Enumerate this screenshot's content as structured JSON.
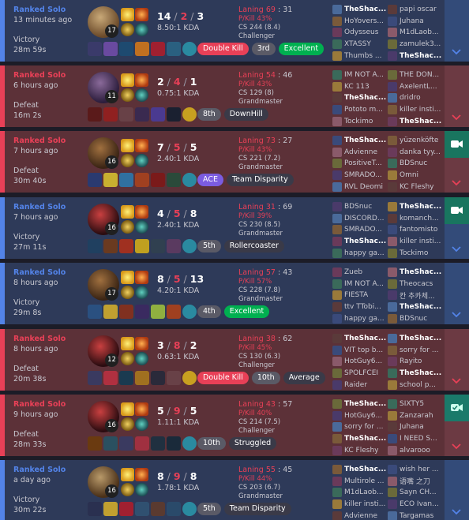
{
  "colors": {
    "win_bg": "#2e3a59",
    "loss_bg": "#5c3138",
    "win_accent": "#5383e8",
    "loss_accent": "#e84057",
    "video_button": "#19755f"
  },
  "icons": {
    "expand": "chevron-down-icon",
    "video": "video-camera-icon",
    "video_check": "video-check-icon"
  },
  "matches": [
    {
      "queue": "Ranked Solo",
      "time_ago": "13 minutes ago",
      "result": "Victory",
      "duration": "28m 59s",
      "champion_level": "17",
      "kills": "14",
      "deaths": "2",
      "assists": "3",
      "kda_ratio": "8.50:1 KDA",
      "badges": [
        {
          "label": "Double Kill",
          "color": "red"
        },
        {
          "label": "3rd",
          "color": "gray"
        },
        {
          "label": "Excellent",
          "color": "green"
        }
      ],
      "laning_label": "Laning 69",
      "laning_opp": ": 31",
      "pkill_label": "P/Kill 43%",
      "cs": "CS 244 (8.4)",
      "tier": "Challenger",
      "team1": [
        "TheShac...",
        "HoYovers...",
        "Odysseus",
        "XTASSY",
        "Thumbs ..."
      ],
      "team2": [
        "papi oscar",
        "Juhana",
        "M1dLaob...",
        "zamulek3...",
        "TheShac..."
      ]
    },
    {
      "queue": "Ranked Solo",
      "time_ago": "6 hours ago",
      "result": "Defeat",
      "duration": "16m 2s",
      "champion_level": "11",
      "kills": "2",
      "deaths": "4",
      "assists": "1",
      "kda_ratio": "0.75:1 KDA",
      "badges": [
        {
          "label": "8th",
          "color": "gray"
        },
        {
          "label": "DownHill",
          "color": "dark"
        }
      ],
      "laning_label": "Laning 54",
      "laning_opp": ": 46",
      "pkill_label": "P/Kill 43%",
      "cs": "CS 129 (8)",
      "tier": "Grandmaster",
      "team1": [
        "IM NOT A...",
        "KC 113",
        "TheShac...",
        "Pototo m...",
        "Tockimo"
      ],
      "team2": [
        "THE DON...",
        "AxelentL...",
        "dridro",
        "killer insti...",
        "TheShac..."
      ]
    },
    {
      "queue": "Ranked Solo",
      "time_ago": "7 hours ago",
      "result": "Defeat",
      "duration": "30m 40s",
      "champion_level": "16",
      "kills": "7",
      "deaths": "5",
      "assists": "5",
      "kda_ratio": "2.40:1 KDA",
      "badges": [
        {
          "label": "ACE",
          "color": "purple"
        },
        {
          "label": "Team Disparity",
          "color": "dark"
        }
      ],
      "laning_label": "Laning 73",
      "laning_opp": ": 27",
      "pkill_label": "P/Kill 43%",
      "cs": "CS 221 (7.2)",
      "tier": "Grandmaster",
      "team1": [
        "TheShac...",
        "Advienne",
        "PositiveT...",
        "SMRADO...",
        "RVL Deomi"
      ],
      "team2": [
        "yüzenköfte",
        "danka tyy...",
        "BDSnuc",
        "Omni",
        "KC Fleshy"
      ]
    },
    {
      "queue": "Ranked Solo",
      "time_ago": "7 hours ago",
      "result": "Victory",
      "duration": "27m 11s",
      "champion_level": "16",
      "kills": "4",
      "deaths": "5",
      "assists": "8",
      "kda_ratio": "2.40:1 KDA",
      "badges": [
        {
          "label": "5th",
          "color": "gray"
        },
        {
          "label": "Rollercoaster",
          "color": "dark"
        }
      ],
      "laning_label": "Laning 31",
      "laning_opp": ": 69",
      "pkill_label": "P/Kill 39%",
      "cs": "CS 230 (8.5)",
      "tier": "Grandmaster",
      "team1": [
        "BDSnuc",
        "DISCORD...",
        "SMRADO...",
        "TheShac...",
        "happy ga..."
      ],
      "team2": [
        "TheShac...",
        "komanch...",
        "fantomisto",
        "killer insti...",
        "Tockimo"
      ]
    },
    {
      "queue": "Ranked Solo",
      "time_ago": "8 hours ago",
      "result": "Victory",
      "duration": "29m 8s",
      "champion_level": "17",
      "kills": "8",
      "deaths": "5",
      "assists": "13",
      "kda_ratio": "4.20:1 KDA",
      "badges": [
        {
          "label": "4th",
          "color": "gray"
        },
        {
          "label": "Excellent",
          "color": "green"
        }
      ],
      "laning_label": "Laning 57",
      "laning_opp": ": 43",
      "pkill_label": "P/Kill 57%",
      "cs": "CS 228 (7.8)",
      "tier": "Grandmaster",
      "team1": [
        "Zueb",
        "IM NOT A...",
        "FIESTA",
        "ttv TTobi...",
        "happy ga..."
      ],
      "team2": [
        "TheShac...",
        "Theocacs",
        "칸 추카체...",
        "TheShac...",
        "BDSnuc"
      ]
    },
    {
      "queue": "Ranked Solo",
      "time_ago": "8 hours ago",
      "result": "Defeat",
      "duration": "20m 38s",
      "champion_level": "12",
      "kills": "3",
      "deaths": "8",
      "assists": "2",
      "kda_ratio": "0.63:1 KDA",
      "badges": [
        {
          "label": "Double Kill",
          "color": "red"
        },
        {
          "label": "10th",
          "color": "gray"
        },
        {
          "label": "Average",
          "color": "dark"
        }
      ],
      "laning_label": "Laning 38",
      "laning_opp": ": 62",
      "pkill_label": "P/Kill 45%",
      "cs": "CS 130 (6.3)",
      "tier": "Challenger",
      "team1": [
        "TheShac...",
        "VIT top b...",
        "HotGuy6...",
        "SPOLFCEI",
        "Raider"
      ],
      "team2": [
        "TheShac...",
        "sorry for ...",
        "Rayito",
        "TheShac...",
        "school p..."
      ]
    },
    {
      "queue": "Ranked Solo",
      "time_ago": "9 hours ago",
      "result": "Defeat",
      "duration": "28m 33s",
      "champion_level": "16",
      "kills": "5",
      "deaths": "9",
      "assists": "5",
      "kda_ratio": "1.11:1 KDA",
      "badges": [
        {
          "label": "10th",
          "color": "gray"
        },
        {
          "label": "Struggled",
          "color": "dark"
        }
      ],
      "laning_label": "Laning 43",
      "laning_opp": ": 57",
      "pkill_label": "P/Kill 40%",
      "cs": "CS 214 (7.5)",
      "tier": "Challenger",
      "team1": [
        "TheShac...",
        "HotGuy6...",
        "sorry for ...",
        "TheShac...",
        "KC Fleshy"
      ],
      "team2": [
        "SIXTY5",
        "Zanzarah",
        "Juhana",
        "I NEED S...",
        "alvarooo"
      ]
    },
    {
      "queue": "Ranked Solo",
      "time_ago": "a day ago",
      "result": "Victory",
      "duration": "30m 22s",
      "champion_level": "16",
      "kills": "8",
      "deaths": "9",
      "assists": "8",
      "kda_ratio": "1.78:1 KDA",
      "badges": [
        {
          "label": "5th",
          "color": "gray"
        },
        {
          "label": "Team Disparity",
          "color": "dark"
        }
      ],
      "laning_label": "Laning 55",
      "laning_opp": ": 45",
      "pkill_label": "P/Kill 44%",
      "cs": "CS 203 (6.7)",
      "tier": "Grandmaster",
      "team1": [
        "TheShac...",
        "Multirole ...",
        "M1dLaob...",
        "killer insti...",
        "Advienne"
      ],
      "team2": [
        "wish her ...",
        "语嘴 之刀",
        "Sayn CH...",
        "ECO Ivan...",
        "Targamas"
      ]
    }
  ]
}
